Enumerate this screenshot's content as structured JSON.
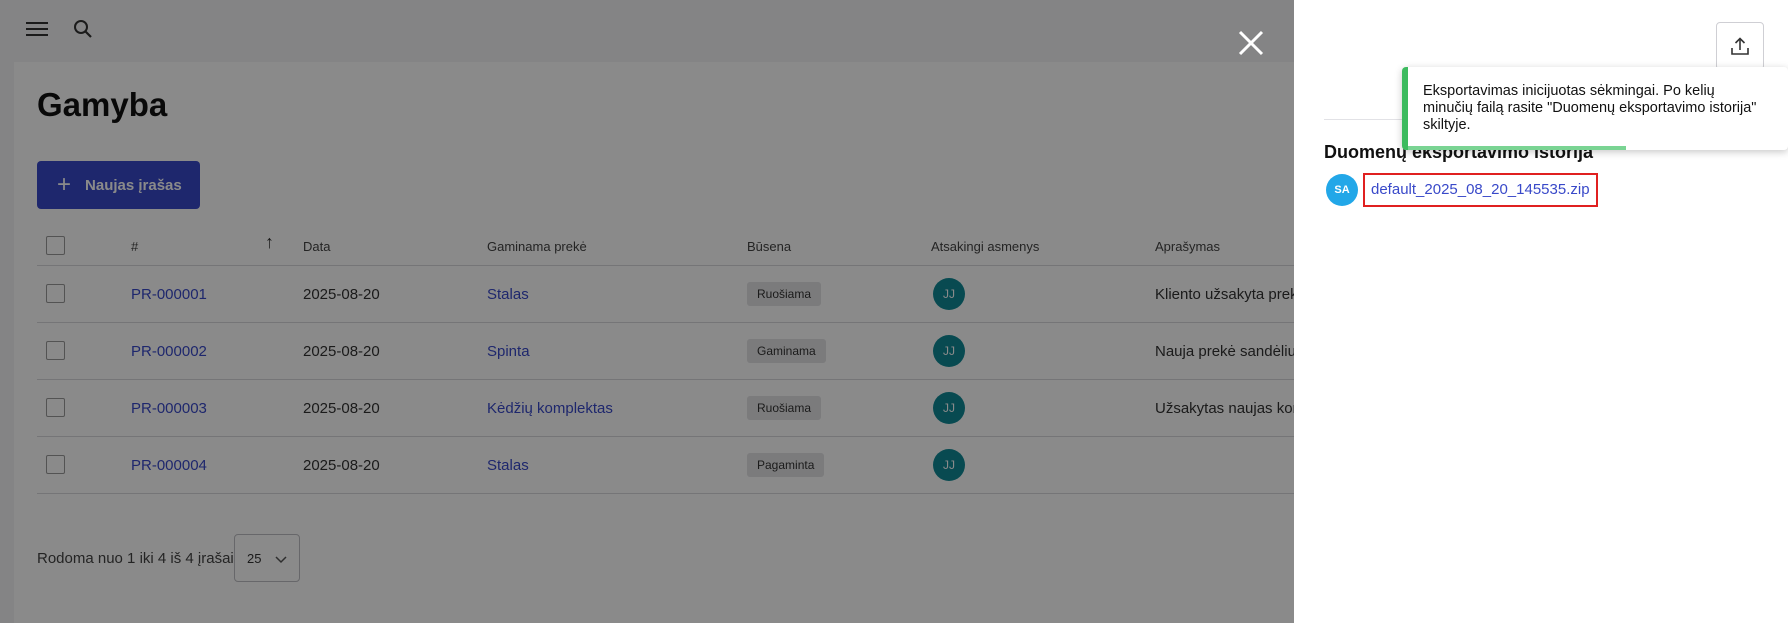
{
  "page": {
    "title": "Gamyba",
    "new_button_label": "Naujas įrašas"
  },
  "table": {
    "headers": {
      "number": "#",
      "date": "Data",
      "product": "Gaminama prekė",
      "status": "Būsena",
      "responsible": "Atsakingi asmenys",
      "description": "Aprašymas"
    },
    "rows": [
      {
        "number": "PR-000001",
        "date": "2025-08-20",
        "product": "Stalas",
        "status": "Ruošiama",
        "responsible": "JJ",
        "description": "Kliento užsakyta prek"
      },
      {
        "number": "PR-000002",
        "date": "2025-08-20",
        "product": "Spinta",
        "status": "Gaminama",
        "responsible": "JJ",
        "description": "Nauja prekė sandėliu"
      },
      {
        "number": "PR-000003",
        "date": "2025-08-20",
        "product": "Kėdžių komplektas",
        "status": "Ruošiama",
        "responsible": "JJ",
        "description": "Užsakytas naujas kor"
      },
      {
        "number": "PR-000004",
        "date": "2025-08-20",
        "product": "Stalas",
        "status": "Pagaminta",
        "responsible": "JJ",
        "description": ""
      }
    ]
  },
  "pagination": {
    "summary": "Rodoma nuo 1 iki 4 iš 4 įrašai",
    "page_size": "25"
  },
  "drawer": {
    "history_title": "Duomenų eksportavimo istorija",
    "entries": [
      {
        "avatar": "SA",
        "file": "default_2025_08_20_145535.zip"
      }
    ]
  },
  "toast": {
    "message": "Eksportavimas inicijuotas sėkmingai. Po kelių minučių failą rasite \"Duomenų eksportavimo istorija\" skiltyje.",
    "accent_color": "#3dbb5f"
  },
  "colors": {
    "primary": "#3949c9",
    "avatar_jj": "#0f8a97",
    "avatar_sa": "#22a7e8",
    "highlight": "#e02020"
  }
}
